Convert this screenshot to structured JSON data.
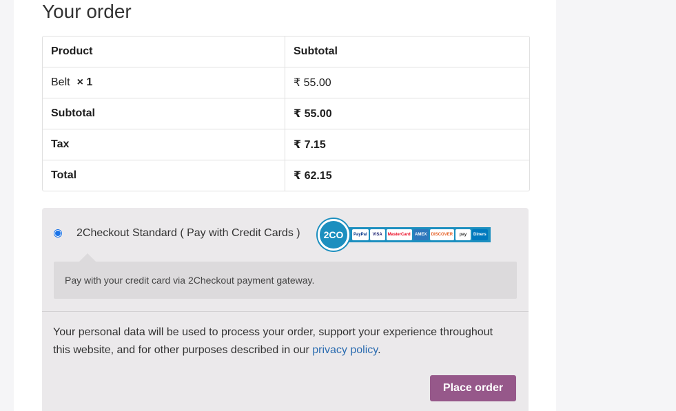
{
  "heading": "Your order",
  "table": {
    "header": {
      "product": "Product",
      "subtotal": "Subtotal"
    },
    "item": {
      "name": "Belt",
      "qty": "× 1",
      "price": "₹ 55.00"
    },
    "subtotal": {
      "label": "Subtotal",
      "value": "₹ 55.00"
    },
    "tax": {
      "label": "Tax",
      "value": "₹ 7.15"
    },
    "total": {
      "label": "Total",
      "value": "₹ 62.15"
    }
  },
  "payment": {
    "method_label": "2Checkout Standard ( Pay with Credit Cards )",
    "logo_text": "2CO",
    "cards": [
      {
        "name": "PayPal",
        "bg": "#ffffff",
        "fg": "#003087"
      },
      {
        "name": "VISA",
        "bg": "#ffffff",
        "fg": "#1a1f71"
      },
      {
        "name": "MasterCard",
        "bg": "#ffffff",
        "fg": "#eb001b"
      },
      {
        "name": "AMEX",
        "bg": "#2e77bc",
        "fg": "#ffffff"
      },
      {
        "name": "DISCOVER",
        "bg": "#ffffff",
        "fg": "#e55c20"
      },
      {
        "name": "pay",
        "bg": "#ffffff",
        "fg": "#333333"
      },
      {
        "name": "Diners",
        "bg": "#0079be",
        "fg": "#ffffff"
      }
    ],
    "description": "Pay with your credit card via 2Checkout payment gateway."
  },
  "privacy": {
    "text": "Your personal data will be used to process your order, support your experience throughout this website, and for other purposes described in our ",
    "link": "privacy policy",
    "end": "."
  },
  "place_order_label": "Place order",
  "colors": {
    "button": "#96588a",
    "payment_bg": "#ebe9eb",
    "link": "#2b6cb0"
  }
}
